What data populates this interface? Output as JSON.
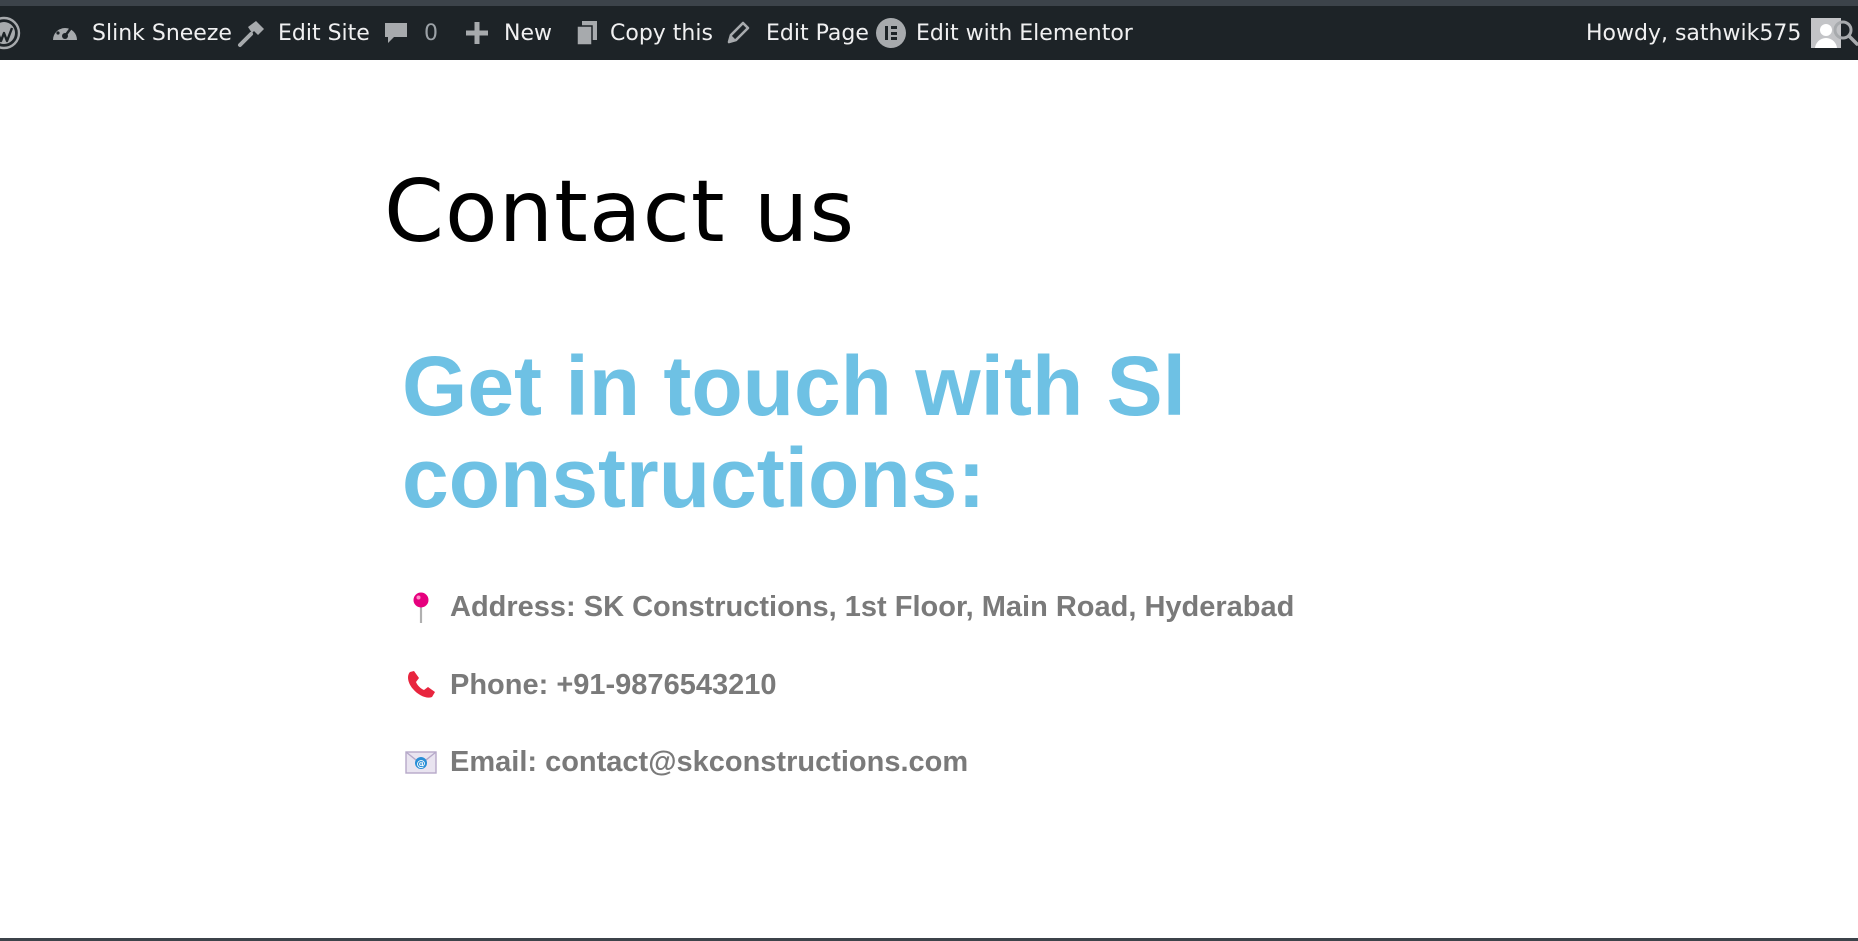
{
  "admin_bar": {
    "site_name": "Slink Sneeze",
    "edit_site": "Edit Site",
    "comments_count": "0",
    "new": "New",
    "copy_this": "Copy this",
    "edit_page": "Edit Page",
    "edit_with_elementor": "Edit with Elementor",
    "howdy": "Howdy, sathwik575",
    "icons": [
      "wordpress-icon",
      "dashboard-icon",
      "hammer-icon",
      "comment-icon",
      "plus-icon",
      "copy-icon",
      "pencil-icon",
      "elementor-icon",
      "avatar",
      "search-icon"
    ]
  },
  "page": {
    "title": "Contact us",
    "heading": "Get in touch with Sl constructions:",
    "address": "Address: SK Constructions, 1st Floor, Main Road, Hyderabad",
    "phone": "Phone: +91-9876543210",
    "email": "Email: contact@skconstructions.com"
  },
  "colors": {
    "admin_bar_bg": "#1d2327",
    "heading_color": "#6ec1e4",
    "body_text_color": "#7a7a7a"
  }
}
